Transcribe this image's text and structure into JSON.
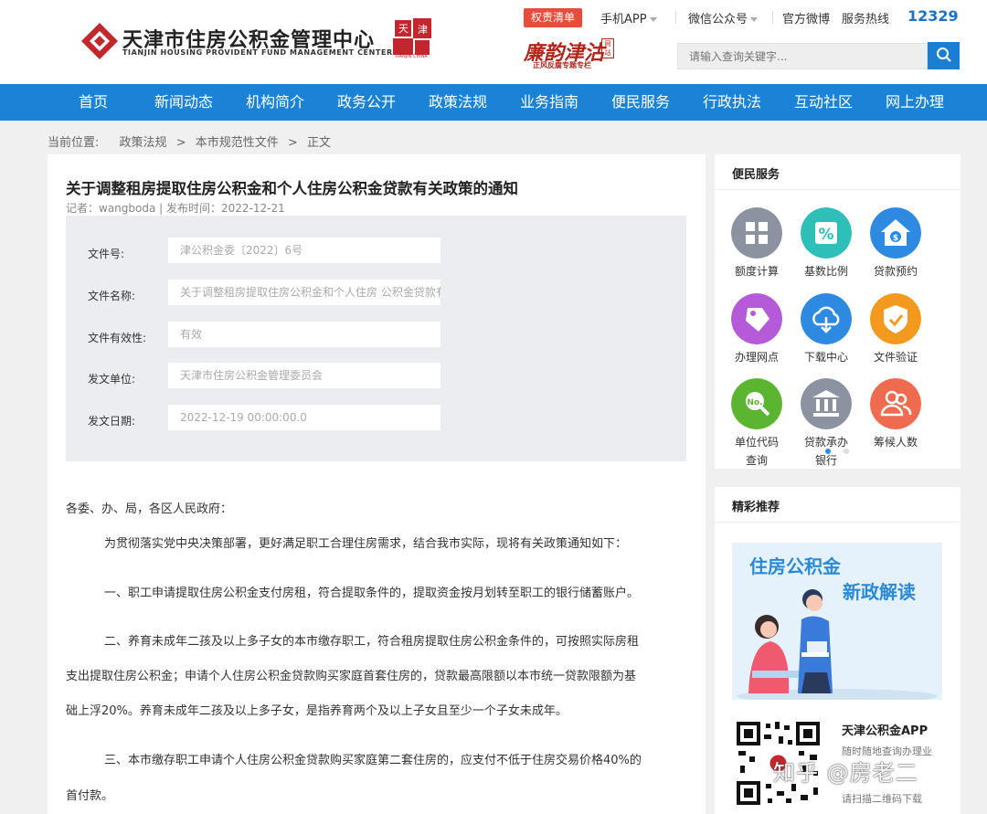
{
  "header": {
    "org_name_cn": "天津市住房公积金管理中心",
    "org_name_en": "TIANJIN HOUSING PROVIDENT FUND MANAGEMENT CENTER",
    "seal_caption": "TIANJIN·CHINA",
    "red_tag": "权责清单",
    "links": {
      "app": "手机APP",
      "wechat": "微信公众号",
      "weibo": "官方微博",
      "hotline_label": "服务热线"
    },
    "hotline": "12329",
    "lianjie_title": "廉韵津沽",
    "lianjie_box": "网站",
    "lianjie_sub": "正风反腐专题专栏",
    "search_placeholder": "请输入查询关键字..."
  },
  "nav": [
    "首页",
    "新闻动态",
    "机构简介",
    "政务公开",
    "政策法规",
    "业务指南",
    "便民服务",
    "行政执法",
    "互动社区",
    "网上办理"
  ],
  "breadcrumb": {
    "label": "当前位置:",
    "items": [
      "政策法规",
      ">",
      "本市规范性文件",
      ">",
      "正文"
    ]
  },
  "article": {
    "title": "关于调整租房提取住房公积金和个人住房公积金贷款有关政策的通知",
    "meta": "记者：wangboda  |  发布时间：2022-12-21",
    "info": [
      {
        "label": "文件号:",
        "value": "津公积金委〔2022〕6号"
      },
      {
        "label": "文件名称:",
        "value": "关于调整租房提取住房公积金和个人住房 公积金贷款有关政策的通知"
      },
      {
        "label": "文件有效性:",
        "value": "有效"
      },
      {
        "label": "发文单位:",
        "value": "天津市住房公积金管理委员会"
      },
      {
        "label": "发文日期:",
        "value": "2022-12-19 00:00:00.0"
      }
    ],
    "para": [
      "各委、办、局，各区人民政府：",
      "为贯彻落实党中央决策部署，更好满足职工合理住房需求，结合我市实际，现将有关政策通知如下：",
      "一、职工申请提取住房公积金支付房租，符合提取条件的，提取资金按月划转至职工的银行储蓄账户。",
      "二、养育未成年二孩及以上多子女的本市缴存职工，符合租房提取住房公积金条件的，可按照实际房租",
      "支出提取住房公积金；申请个人住房公积金贷款购买家庭首套住房的，贷款最高限额以本市统一贷款限额为基",
      "础上浮20%。养育未成年二孩及以上多子女，是指养育两个及以上子女且至少一个子女未成年。",
      "三、本市缴存职工申请个人住房公积金贷款购买家庭第二套住房的，应支付不低于住房交易价格40%的",
      "首付款。"
    ]
  },
  "sidebar": {
    "service_title": "便民服务",
    "services": [
      {
        "label": "额度计算",
        "icon": "calculator-icon",
        "color": "#8b93a1"
      },
      {
        "label": "基数比例",
        "icon": "percent-icon",
        "color": "#2dbfb8"
      },
      {
        "label": "贷款预约",
        "icon": "house-money-icon",
        "color": "#2d8ae0"
      },
      {
        "label": "办理网点",
        "icon": "tag-icon",
        "color": "#b55ad8"
      },
      {
        "label": "下载中心",
        "icon": "cloud-download-icon",
        "color": "#2d8ae0"
      },
      {
        "label": "文件验证",
        "icon": "shield-check-icon",
        "color": "#f39a1e"
      },
      {
        "label": "单位代码查询",
        "label_line1": "单位代码",
        "label_line2": "查询",
        "icon": "search-no-icon",
        "color": "#5cb531"
      },
      {
        "label": "贷款承办银行",
        "label_line1": "贷款承办",
        "label_line2": "银行",
        "icon": "bank-icon",
        "color": "#8b93a1"
      },
      {
        "label": "筹候人数",
        "icon": "people-icon",
        "color": "#ef6b4f"
      }
    ],
    "recommend_title": "精彩推荐",
    "banner_line1": "住房公积金",
    "banner_line2": "新政解读",
    "app_name": "天津公积金APP",
    "app_sub": "随时随地查询办理业",
    "app_sub2": "请扫描二维码下载"
  },
  "watermark": "知乎 @房老二"
}
